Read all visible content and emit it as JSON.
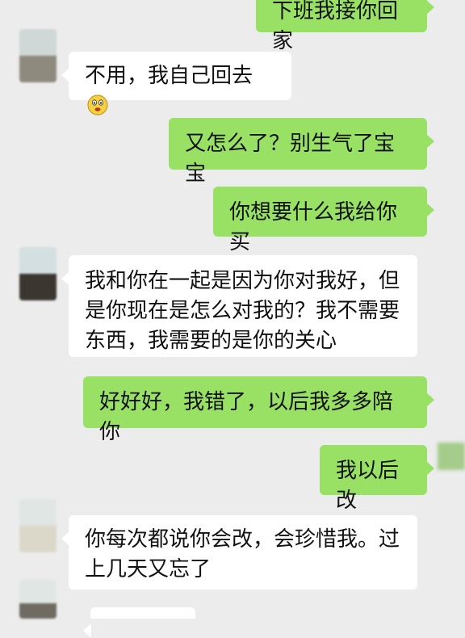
{
  "messages": [
    {
      "side": "out",
      "text": "下班我接你回家"
    },
    {
      "side": "in",
      "text": "不用，我自己回去",
      "emoji": "confused-face-emoji"
    },
    {
      "side": "out",
      "text": "又怎么了？别生气了宝宝"
    },
    {
      "side": "out",
      "text": "你想要什么我给你买"
    },
    {
      "side": "in",
      "lines": [
        "我和你在一起是因为你对我好，但",
        "是你现在是怎么对我的？我不需要",
        "东西，我需要的是你的关心"
      ]
    },
    {
      "side": "out",
      "text": "好好好，我错了，以后我多多陪你"
    },
    {
      "side": "out",
      "text": "我以后改"
    },
    {
      "side": "in",
      "lines": [
        "你每次都说你会改，会珍惜我。过",
        "上几天又忘了"
      ]
    },
    {
      "side": "in",
      "text": ""
    }
  ],
  "colors": {
    "background": "#ececec",
    "incoming_bubble": "#ffffff",
    "outgoing_bubble": "#98e165"
  }
}
